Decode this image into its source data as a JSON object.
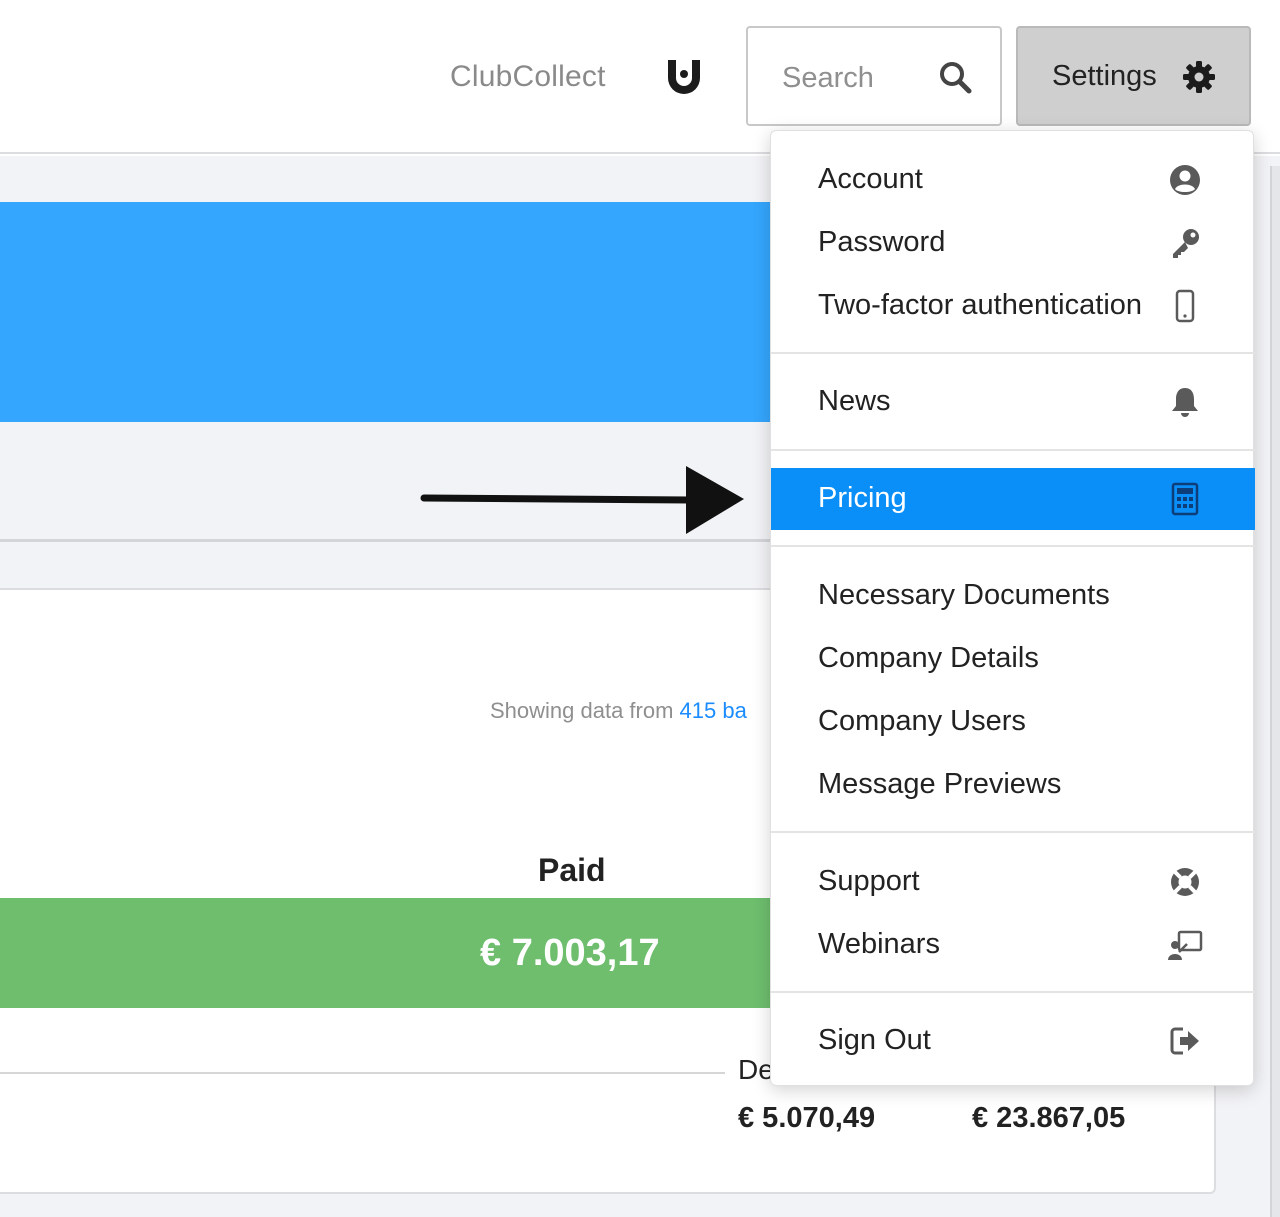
{
  "header": {
    "brand": "ClubCollect",
    "search": {
      "placeholder": "Search",
      "value": ""
    },
    "settings_label": "Settings"
  },
  "dashboard": {
    "showing_prefix": "Showing data from ",
    "showing_link": "415 ba",
    "paid_label": "Paid",
    "paid_value": "€ 7.003,17",
    "column_label_partial": "De",
    "amounts": [
      "€ 5.070,49",
      "€ 23.867,05"
    ]
  },
  "settings_menu": {
    "account": "Account",
    "password": "Password",
    "two_factor": "Two-factor authentication",
    "news": "News",
    "pricing": "Pricing",
    "necessary_documents": "Necessary Documents",
    "company_details": "Company Details",
    "company_users": "Company Users",
    "message_previews": "Message Previews",
    "support": "Support",
    "webinars": "Webinars",
    "sign_out": "Sign Out",
    "active_item": "Pricing"
  },
  "colors": {
    "banner_blue": "#34a6fd",
    "active_item_blue": "#0a8ef8",
    "paid_green": "#6ebe6e",
    "link_blue": "#1a8cff",
    "settings_button_gray": "#cfcfcf"
  },
  "icons": {
    "logo": "clubcollect-logo-icon",
    "search": "search-icon",
    "settings": "gear-icon",
    "account": "user-circle-icon",
    "password": "key-icon",
    "two_factor": "mobile-phone-icon",
    "news": "bell-icon",
    "pricing": "calculator-icon",
    "support": "life-ring-icon",
    "webinars": "presentation-icon",
    "sign_out": "sign-out-icon"
  }
}
